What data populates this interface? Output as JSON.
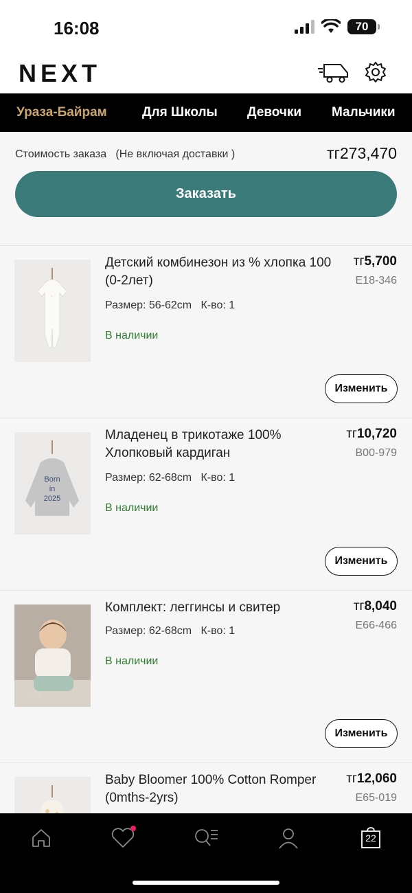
{
  "status": {
    "time": "16:08",
    "battery": "70"
  },
  "header": {
    "logo": "NEXT"
  },
  "nav": [
    "Ураза-Байрам",
    "Для Школы",
    "Девочки",
    "Мальчики"
  ],
  "summary": {
    "label": "Стоимость заказа   (Не включая доставки )",
    "total": "тг273,470",
    "order_button": "Заказать"
  },
  "items": [
    {
      "title": "Детский комбинезон из % хлопка 100 (0-2лет)",
      "price_currency": "тг",
      "price_value": "5,700",
      "code": "E18-346",
      "size": "Размер: 56-62cm",
      "qty": "К-во: 1",
      "stock": "В наличии",
      "change": "Изменить"
    },
    {
      "title": "Младенец в трикотаже 100% Хлопковый кардиган",
      "price_currency": "тг",
      "price_value": "10,720",
      "code": "B00-979",
      "size": "Размер: 62-68cm",
      "qty": "К-во: 1",
      "stock": "В наличии",
      "change": "Изменить",
      "image_text": [
        "Born",
        "in",
        "2025"
      ]
    },
    {
      "title": "Комплект: леггинсы и свитер",
      "price_currency": "тг",
      "price_value": "8,040",
      "code": "E66-466",
      "size": "Размер: 62-68cm",
      "qty": "К-во: 1",
      "stock": "В наличии",
      "change": "Изменить"
    },
    {
      "title": "Baby Bloomer 100% Cotton Romper (0mths-2yrs)",
      "price_currency": "тг",
      "price_value": "12,060",
      "code": "E65-019"
    }
  ],
  "tabbar": {
    "icons": [
      "home-icon",
      "heart-icon",
      "search-list-icon",
      "user-icon",
      "bag-icon"
    ],
    "bag_count": "22",
    "accent": "#e91e63"
  },
  "colors": {
    "primary_button": "#3a7a79",
    "nav_active": "#c9a56c",
    "in_stock": "#2e7d32"
  }
}
